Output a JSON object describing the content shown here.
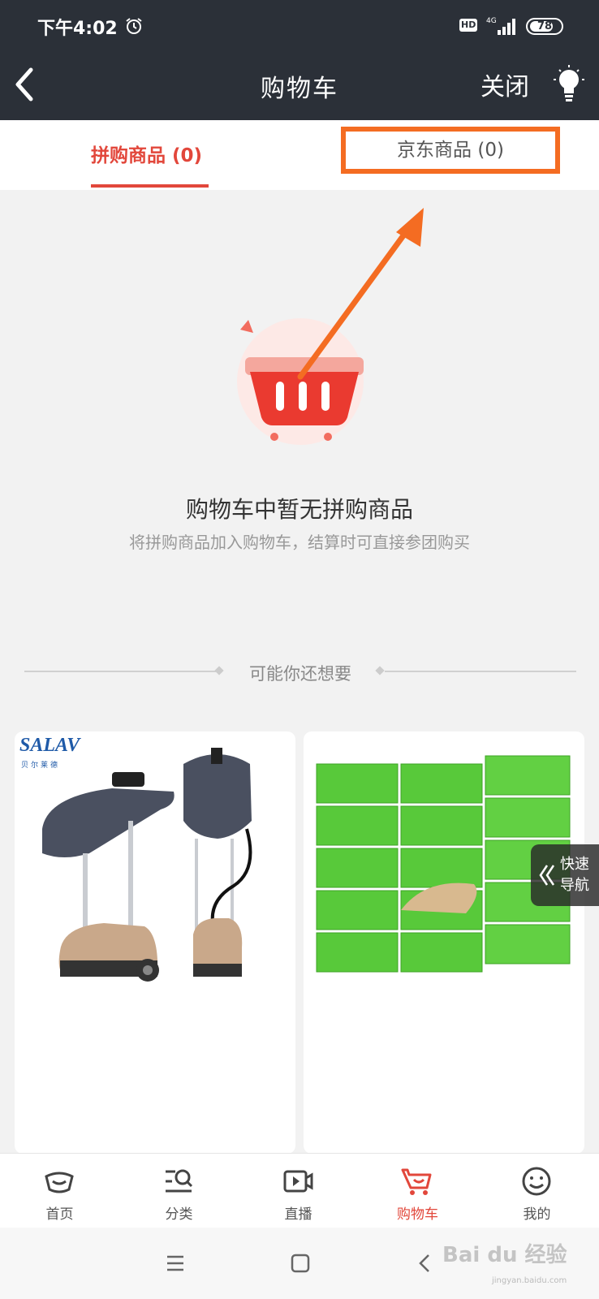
{
  "status": {
    "time": "下午4:02",
    "hd": "HD",
    "network": "4G",
    "battery": "78",
    "battery_level": 0.78
  },
  "header": {
    "title": "购物车",
    "close_label": "关闭"
  },
  "tabs": [
    {
      "label": "拼购商品 (0)",
      "active": true
    },
    {
      "label": "京东商品 (0)",
      "active": false,
      "highlighted": true
    }
  ],
  "empty": {
    "title": "购物车中暂无拼购商品",
    "subtitle": "将拼购商品加入购物车，结算时可直接参团购买"
  },
  "recommend": {
    "title": "可能你还想要"
  },
  "products": [
    {
      "brand": "SALAV",
      "brand_sub": "贝尔莱德",
      "image": "garment-steamer-image"
    },
    {
      "image": "tissue-pack-image"
    }
  ],
  "quick_nav": {
    "line1": "快速",
    "line2": "导航"
  },
  "bottom_nav": [
    {
      "label": "首页",
      "icon": "home-icon",
      "active": false
    },
    {
      "label": "分类",
      "icon": "category-search-icon",
      "active": false
    },
    {
      "label": "直播",
      "icon": "live-video-icon",
      "active": false
    },
    {
      "label": "购物车",
      "icon": "cart-icon",
      "active": true
    },
    {
      "label": "我的",
      "icon": "profile-smile-icon",
      "active": false
    }
  ],
  "watermark": {
    "text": "Bai du 经验",
    "sub": "jingyan.baidu.com"
  },
  "colors": {
    "accent": "#e2473b",
    "highlight_box": "#f46c22",
    "header_bg": "#2b3038"
  }
}
